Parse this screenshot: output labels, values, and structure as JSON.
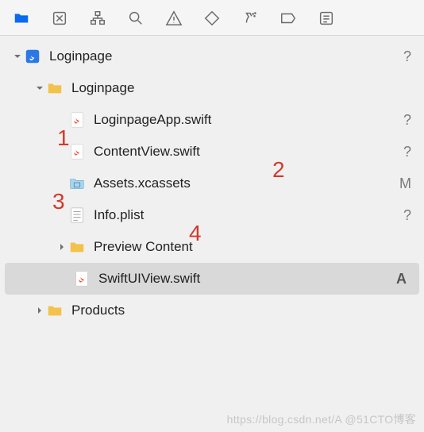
{
  "toolbar": {
    "icons": [
      "folder",
      "box-x",
      "hierarchy",
      "search",
      "warning",
      "diamond",
      "spray",
      "tag",
      "list"
    ]
  },
  "tree": {
    "root": {
      "label": "Loginpage",
      "status": "?",
      "expanded": true,
      "children": {
        "loginpage_folder": {
          "label": "Loginpage",
          "expanded": true,
          "items": [
            {
              "label": "LoginpageApp.swift",
              "status": "?",
              "type": "swift"
            },
            {
              "label": "ContentView.swift",
              "status": "?",
              "type": "swift"
            },
            {
              "label": "Assets.xcassets",
              "status": "M",
              "type": "assets"
            },
            {
              "label": "Info.plist",
              "status": "?",
              "type": "plist"
            },
            {
              "label": "Preview Content",
              "status": "",
              "type": "folder",
              "hasChildren": true
            },
            {
              "label": "SwiftUIView.swift",
              "status": "A",
              "type": "swift",
              "selected": true
            }
          ]
        },
        "products": {
          "label": "Products",
          "expanded": false
        }
      }
    }
  },
  "annotations": {
    "a1": "1",
    "a2": "2",
    "a3": "3",
    "a4": "4"
  },
  "watermark": "https://blog.csdn.net/A @51CTO博客"
}
